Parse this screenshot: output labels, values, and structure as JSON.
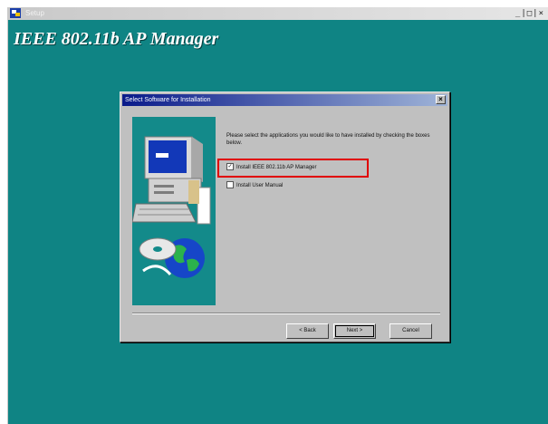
{
  "window": {
    "title": "Setup",
    "controls": "_|□|×",
    "banner": "IEEE 802.11b AP Manager"
  },
  "dialog": {
    "title": "Select Software for Installation",
    "close_label": "×",
    "instructions": "Please select the applications you would like to have installed by checking the boxes below.",
    "options": [
      {
        "label": "Install IEEE 802.11b AP Manager",
        "checked": true
      },
      {
        "label": "Install User Manual",
        "checked": false
      }
    ],
    "buttons": {
      "back": "< Back",
      "next": "Next >",
      "cancel": "Cancel"
    }
  },
  "colors": {
    "desktop_teal": "#0f8484",
    "highlight_box": "#e00000",
    "dialog_gray": "#c0c0c0"
  }
}
